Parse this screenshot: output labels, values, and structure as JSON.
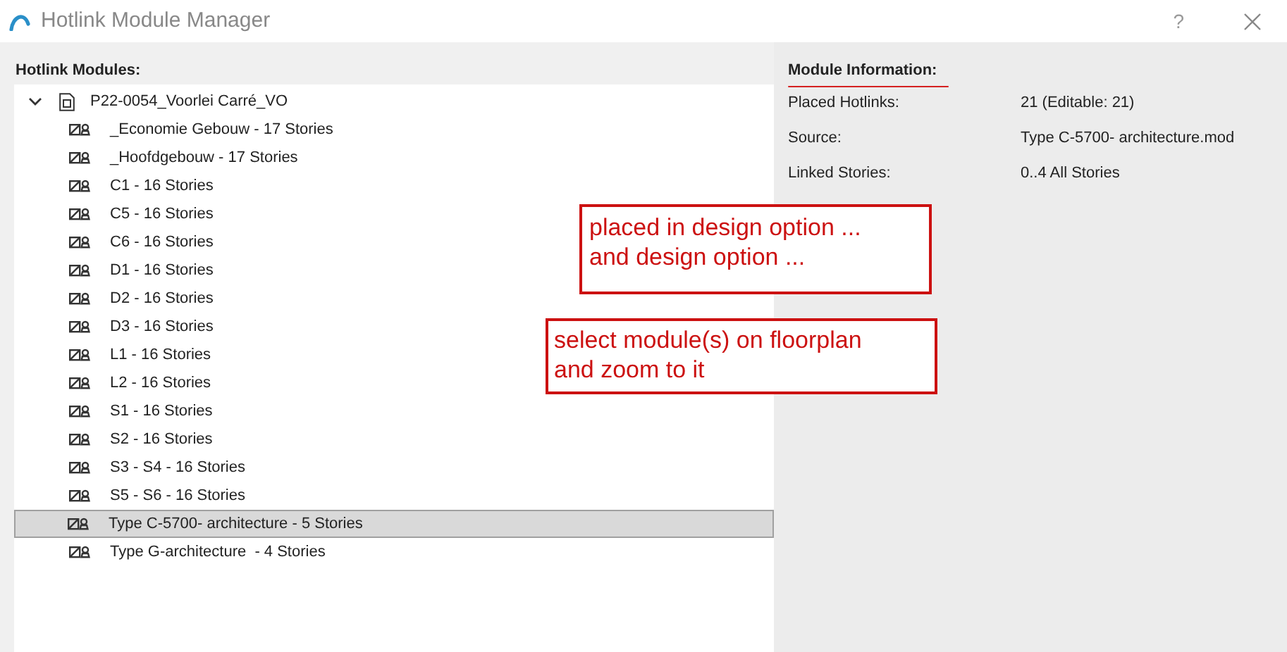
{
  "window": {
    "title": "Hotlink Module Manager",
    "help": "?"
  },
  "modules": {
    "heading": "Hotlink Modules:",
    "tree": [
      {
        "label": "P22-0054_Voorlei Carré_VO",
        "expanded": true,
        "children": [
          {
            "label": "_Economie Gebouw - 17 Stories",
            "selected": false
          },
          {
            "label": "_Hoofdgebouw - 17 Stories",
            "selected": false
          },
          {
            "label": "C1 - 16 Stories",
            "selected": false
          },
          {
            "label": "C5 - 16 Stories",
            "selected": false
          },
          {
            "label": "C6 - 16 Stories",
            "selected": false
          },
          {
            "label": "D1 - 16 Stories",
            "selected": false
          },
          {
            "label": "D2 - 16 Stories",
            "selected": false
          },
          {
            "label": "D3 - 16 Stories",
            "selected": false
          },
          {
            "label": "L1 - 16 Stories",
            "selected": false
          },
          {
            "label": "L2 - 16 Stories",
            "selected": false
          },
          {
            "label": "S1 - 16 Stories",
            "selected": false
          },
          {
            "label": "S2 - 16 Stories",
            "selected": false
          },
          {
            "label": "S3 - S4 - 16 Stories",
            "selected": false
          },
          {
            "label": "S5 - S6 - 16 Stories",
            "selected": false
          },
          {
            "label": "Type C-5700- architecture - 5 Stories",
            "selected": true
          },
          {
            "label": "Type G-architecture  - 4 Stories",
            "selected": false
          }
        ]
      }
    ]
  },
  "info": {
    "heading": "Module Information:",
    "rows": [
      {
        "label": "Placed Hotlinks:",
        "value": "21 (Editable: 21)"
      },
      {
        "label": "Source:",
        "value": "Type C-5700- architecture.mod"
      },
      {
        "label": "Linked Stories:",
        "value": "0..4 All Stories"
      }
    ]
  },
  "annotations": [
    {
      "lines": [
        "placed in design option ...",
        "and design option ..."
      ]
    },
    {
      "lines": [
        "select module(s) on floorplan",
        "and zoom to it"
      ]
    }
  ]
}
